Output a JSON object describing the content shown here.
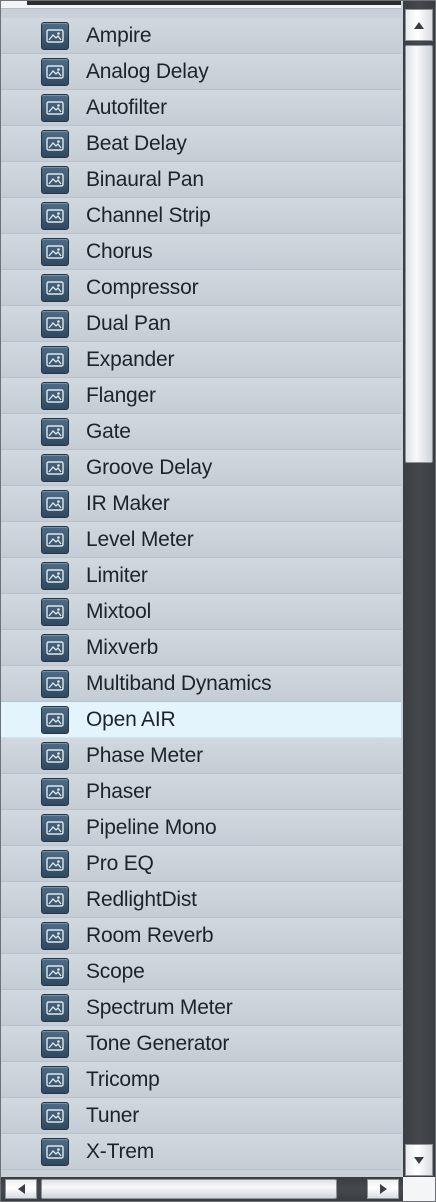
{
  "plugins": {
    "selected_index": 19,
    "icon": "plugin-icon",
    "items": [
      {
        "label": "Ampire"
      },
      {
        "label": "Analog Delay"
      },
      {
        "label": "Autofilter"
      },
      {
        "label": "Beat Delay"
      },
      {
        "label": "Binaural Pan"
      },
      {
        "label": "Channel Strip"
      },
      {
        "label": "Chorus"
      },
      {
        "label": "Compressor"
      },
      {
        "label": "Dual Pan"
      },
      {
        "label": "Expander"
      },
      {
        "label": "Flanger"
      },
      {
        "label": "Gate"
      },
      {
        "label": "Groove Delay"
      },
      {
        "label": "IR Maker"
      },
      {
        "label": "Level Meter"
      },
      {
        "label": "Limiter"
      },
      {
        "label": "Mixtool"
      },
      {
        "label": "Mixverb"
      },
      {
        "label": "Multiband Dynamics"
      },
      {
        "label": "Open AIR"
      },
      {
        "label": "Phase Meter"
      },
      {
        "label": "Phaser"
      },
      {
        "label": "Pipeline Mono"
      },
      {
        "label": "Pro EQ"
      },
      {
        "label": "RedlightDist"
      },
      {
        "label": "Room Reverb"
      },
      {
        "label": "Scope"
      },
      {
        "label": "Spectrum Meter"
      },
      {
        "label": "Tone Generator"
      },
      {
        "label": "Tricomp"
      },
      {
        "label": "Tuner"
      },
      {
        "label": "X-Trem"
      }
    ]
  },
  "colors": {
    "row": "#c9d0d8",
    "selected_row": "#e3f4fc",
    "text": "#1d232b",
    "icon": "#3f5a73",
    "scrollbar_track": "#3f4247"
  }
}
